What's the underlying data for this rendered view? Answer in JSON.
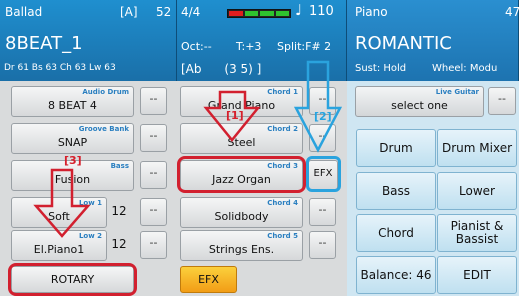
{
  "left_header": {
    "style_name": "Ballad",
    "bank": "[A]",
    "number": "52",
    "main_style": "8BEAT_1",
    "volumes": "Dr 61  Bs 63  Ch 63  Lw 63"
  },
  "mid_header": {
    "time_sig": "4/4",
    "tempo": "110",
    "octave": "Oct:--",
    "transpose": "T:+3",
    "split": "Split:F# 2",
    "chord_info": "[Ab      (3 5) ]"
  },
  "right_header": {
    "title": "Piano",
    "number": "47",
    "sound": "ROMANTIC",
    "sustain": "Sust: Hold",
    "wheel": "Wheel: Modu"
  },
  "left_col": [
    {
      "tag": "Audio Drum",
      "label": "8 BEAT 4",
      "side": "--",
      "side_num": ""
    },
    {
      "tag": "Groove Bank",
      "label": "SNAP",
      "side": "--",
      "side_num": ""
    },
    {
      "tag": "Bass",
      "label": "Fusion",
      "side": "--",
      "side_num": ""
    },
    {
      "tag": "Low 1",
      "label": "Soft",
      "side": "--",
      "side_num": "12"
    },
    {
      "tag": "Low 2",
      "label": "El.Piano1",
      "side": "--",
      "side_num": "12"
    }
  ],
  "rotary_label": "ROTARY",
  "chord_col": [
    {
      "tag": "Chord 1",
      "label": "Grand Piano",
      "side": "--"
    },
    {
      "tag": "Chord 2",
      "label": "Steel",
      "side": "--"
    },
    {
      "tag": "Chord 3",
      "label": "Jazz Organ",
      "side": "EFX"
    },
    {
      "tag": "Chord 4",
      "label": "Solidbody",
      "side": "--"
    },
    {
      "tag": "Chord 5",
      "label": "Strings Ens.",
      "side": "--"
    }
  ],
  "efx_label": "EFX",
  "live_guitar": {
    "tag": "Live Guitar",
    "label": "select one",
    "side": "--"
  },
  "right_buttons": [
    {
      "label": "Drum"
    },
    {
      "label": "Drum Mixer"
    },
    {
      "label": "Bass"
    },
    {
      "label": "Lower"
    },
    {
      "label": "Chord"
    },
    {
      "label": "Pianist & Bassist"
    },
    {
      "label": "Balance: 46"
    },
    {
      "label": "EDIT"
    }
  ],
  "annotations": {
    "one": "[1]",
    "two": "[2]",
    "three": "[3]"
  },
  "colors": {
    "header_blue": "#1a7bbb",
    "accent_red": "#d2202f",
    "accent_blue": "#2aa3de",
    "efx_yellow": "#f6b623"
  }
}
